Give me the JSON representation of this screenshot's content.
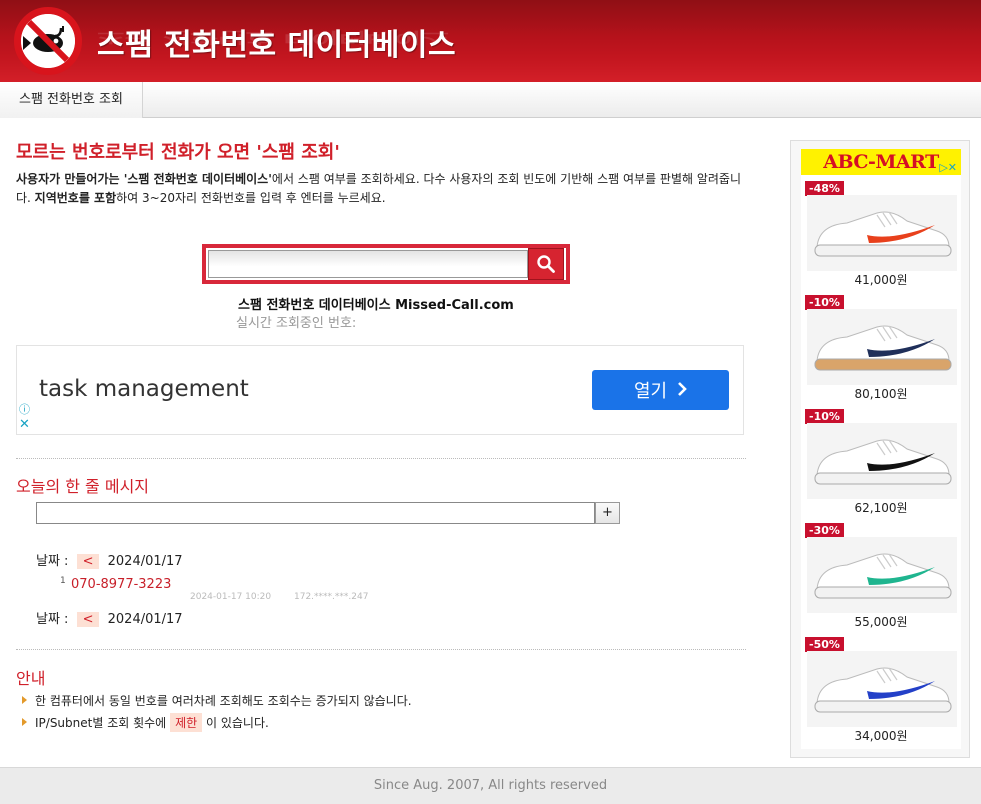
{
  "header": {
    "site_title": "스팸 전화번호 데이터베이스"
  },
  "nav": {
    "items": [
      {
        "label": "스팸 전화번호 조회"
      }
    ]
  },
  "main": {
    "heading": "모르는 번호로부터 전화가 오면 '스팸 조회'",
    "intro": {
      "part1_bold": "사용자가 만들어가는 '스팸 전화번호 데이터베이스'",
      "part2": "에서 스팸 여부를 조회하세요. 다수 사용자의 조회 빈도에 기반해 스팸 여부를 판별해 알려줍니다. ",
      "part3_bold": "지역번호를 포함",
      "part4": "하여 3~20자리 전화번호를 입력 후 엔터를 누르세요."
    },
    "search": {
      "value": ""
    },
    "site_caption": "스팸 전화번호 데이터베이스 Missed-Call.com",
    "live_caption": "실시간 조회중인 번호:",
    "ad": {
      "text": "task management",
      "button": "열기"
    }
  },
  "message": {
    "title": "오늘의 한 줄 메시지",
    "input_value": "",
    "add_label": "+",
    "date_label": "날짜 :",
    "prev_label": "<",
    "date": "2024/01/17",
    "entries": [
      {
        "num": "1",
        "phone": "070-8977-3223",
        "time": "2024-01-17 10:20",
        "ip": "172.****.***.247"
      }
    ]
  },
  "notice": {
    "title": "안내",
    "items": [
      "한 컴퓨터에서 동일 번호를 여러차례 조회해도 조회수는 증가되지 않습니다.",
      "IP/Subnet별 조회 횟수에"
    ],
    "limit_tag": "제한",
    "item2_suffix": "이 있습니다."
  },
  "side_ad": {
    "brand": "ABC-MART",
    "products": [
      {
        "discount": "-48%",
        "price": "41,000원",
        "accent": "#e8401c"
      },
      {
        "discount": "-10%",
        "price": "80,100원",
        "accent": "#1f2f5a"
      },
      {
        "discount": "-10%",
        "price": "62,100원",
        "accent": "#111111"
      },
      {
        "discount": "-30%",
        "price": "55,000원",
        "accent": "#1fb58f"
      },
      {
        "discount": "-50%",
        "price": "34,000원",
        "accent": "#2340c8"
      }
    ]
  },
  "footer": {
    "text": "Since Aug. 2007, All rights reserved"
  },
  "colors": {
    "brand_red": "#c3161f",
    "accent_red": "#d0202a",
    "ad_blue": "#1a73e8"
  }
}
